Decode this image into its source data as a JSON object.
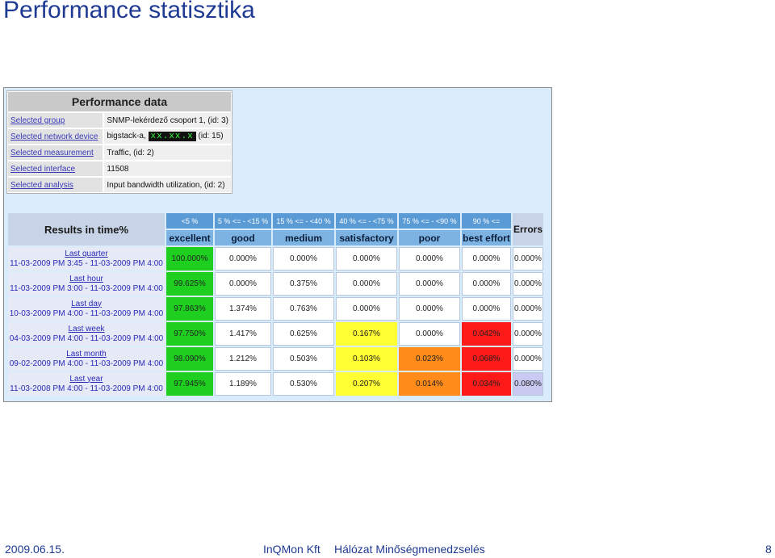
{
  "slide": {
    "title": "Performance statisztika",
    "footer_date": "2009.06.15.",
    "footer_company": "InQMon Kft",
    "footer_subject": "Hálózat Minőségmenedzselés",
    "page_number": "8"
  },
  "performance": {
    "header": "Performance data",
    "rows": [
      {
        "label": "Selected group",
        "value": "SNMP-lekérdező csoport 1, (id: 3)"
      },
      {
        "label": "Selected network device",
        "value_prefix": "bigstack-a,",
        "ip": "xx.xx.x",
        "value_suffix": "(id: 15)"
      },
      {
        "label": "Selected measurement",
        "value": "Traffic, (id: 2)"
      },
      {
        "label": "Selected interface",
        "value": "11508"
      },
      {
        "label": "Selected analysis",
        "value": "Input bandwidth utilization, (id: 2)"
      }
    ]
  },
  "results": {
    "header": "Results in time%",
    "errors_header": "Errors",
    "ranges": [
      "<5 %",
      "5 % <= - <15 %",
      "15 % <= - <40 %",
      "40 % <= - <75 %",
      "75 % <= - <90 %",
      "90 % <="
    ],
    "categories": [
      "excellent",
      "good",
      "medium",
      "satisfactory",
      "poor",
      "best effort"
    ],
    "category_colors": [
      "#1fcf1f",
      "#ffffff",
      "#ffffff",
      "#ffff33",
      "#ff8c1a",
      "#ff1a1a"
    ],
    "rows": [
      {
        "period": "Last quarter",
        "range": "11-03-2009 PM 3:45 - 11-03-2009 PM 4:00",
        "values": [
          "100.000%",
          "0.000%",
          "0.000%",
          "0.000%",
          "0.000%",
          "0.000%"
        ],
        "errors": "0.000%"
      },
      {
        "period": "Last hour",
        "range": "11-03-2009 PM 3:00 - 11-03-2009 PM 4:00",
        "values": [
          "99.625%",
          "0.000%",
          "0.375%",
          "0.000%",
          "0.000%",
          "0.000%"
        ],
        "errors": "0.000%"
      },
      {
        "period": "Last day",
        "range": "10-03-2009 PM 4:00 - 11-03-2009 PM 4:00",
        "values": [
          "97.863%",
          "1.374%",
          "0.763%",
          "0.000%",
          "0.000%",
          "0.000%"
        ],
        "errors": "0.000%"
      },
      {
        "period": "Last week",
        "range": "04-03-2009 PM 4:00 - 11-03-2009 PM 4:00",
        "values": [
          "97.750%",
          "1.417%",
          "0.625%",
          "0.167%",
          "0.000%",
          "0.042%"
        ],
        "errors": "0.000%"
      },
      {
        "period": "Last month",
        "range": "09-02-2009 PM 4:00 - 11-03-2009 PM 4:00",
        "values": [
          "98.090%",
          "1.212%",
          "0.503%",
          "0.103%",
          "0.023%",
          "0.068%"
        ],
        "errors": "0.000%"
      },
      {
        "period": "Last year",
        "range": "11-03-2008 PM 4:00 - 11-03-2009 PM 4:00",
        "values": [
          "97.945%",
          "1.189%",
          "0.530%",
          "0.207%",
          "0.014%",
          "0.034%"
        ],
        "errors": "0.080%"
      }
    ]
  }
}
